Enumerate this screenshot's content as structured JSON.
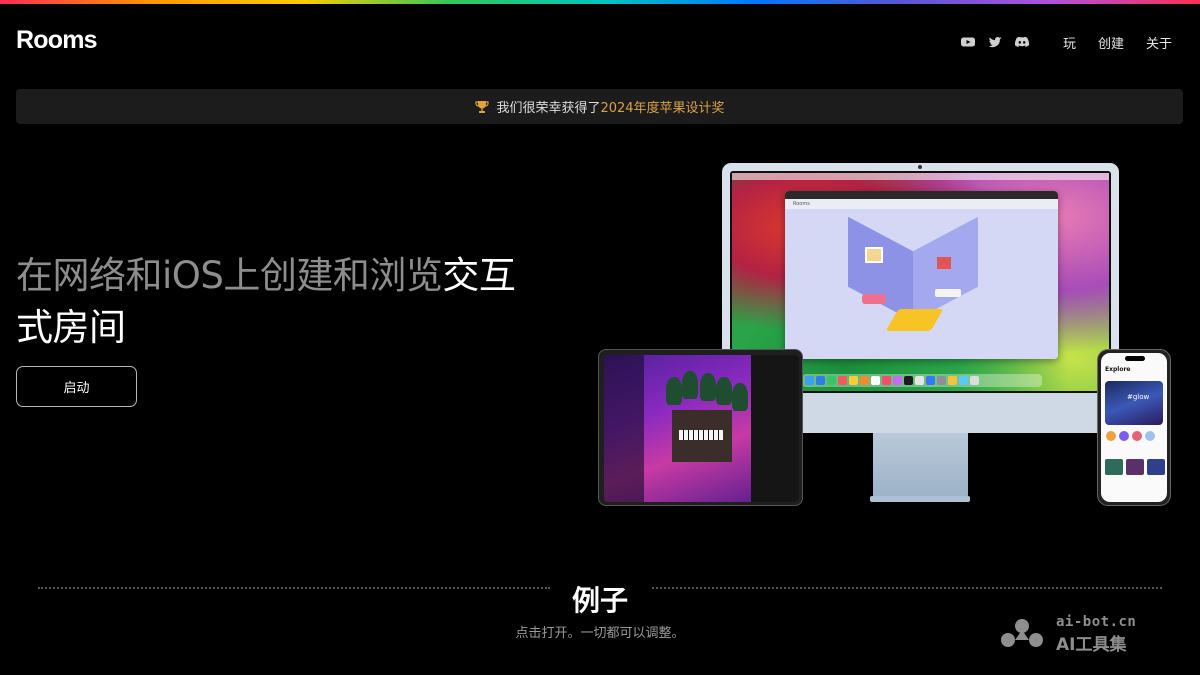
{
  "brand": {
    "logo": "Rooms"
  },
  "nav": {
    "icons": [
      "youtube-icon",
      "twitter-icon",
      "discord-icon"
    ],
    "links": [
      "玩",
      "创建",
      "关于"
    ]
  },
  "banner": {
    "prefix": "我们很荣幸获得了",
    "highlight": "2024年度苹果设计奖",
    "icon": "trophy-icon"
  },
  "hero": {
    "title_dim": "在网络和iOS上创建和浏览",
    "title_bright_1": "交互",
    "title_bright_2": "式房间",
    "cta": "启动"
  },
  "devices": {
    "imac_window_title": "Rooms",
    "phone_title": "Explore",
    "phone_card_text": "#glow"
  },
  "examples": {
    "title": "例子",
    "subtitle": "点击打开。一切都可以调整。"
  },
  "watermark": {
    "top": "ai-bot.cn",
    "bottom": "AI工具集"
  },
  "colors": {
    "highlight": "#d9a24a",
    "banner_bg": "#1c1c1c",
    "background": "#000000"
  }
}
